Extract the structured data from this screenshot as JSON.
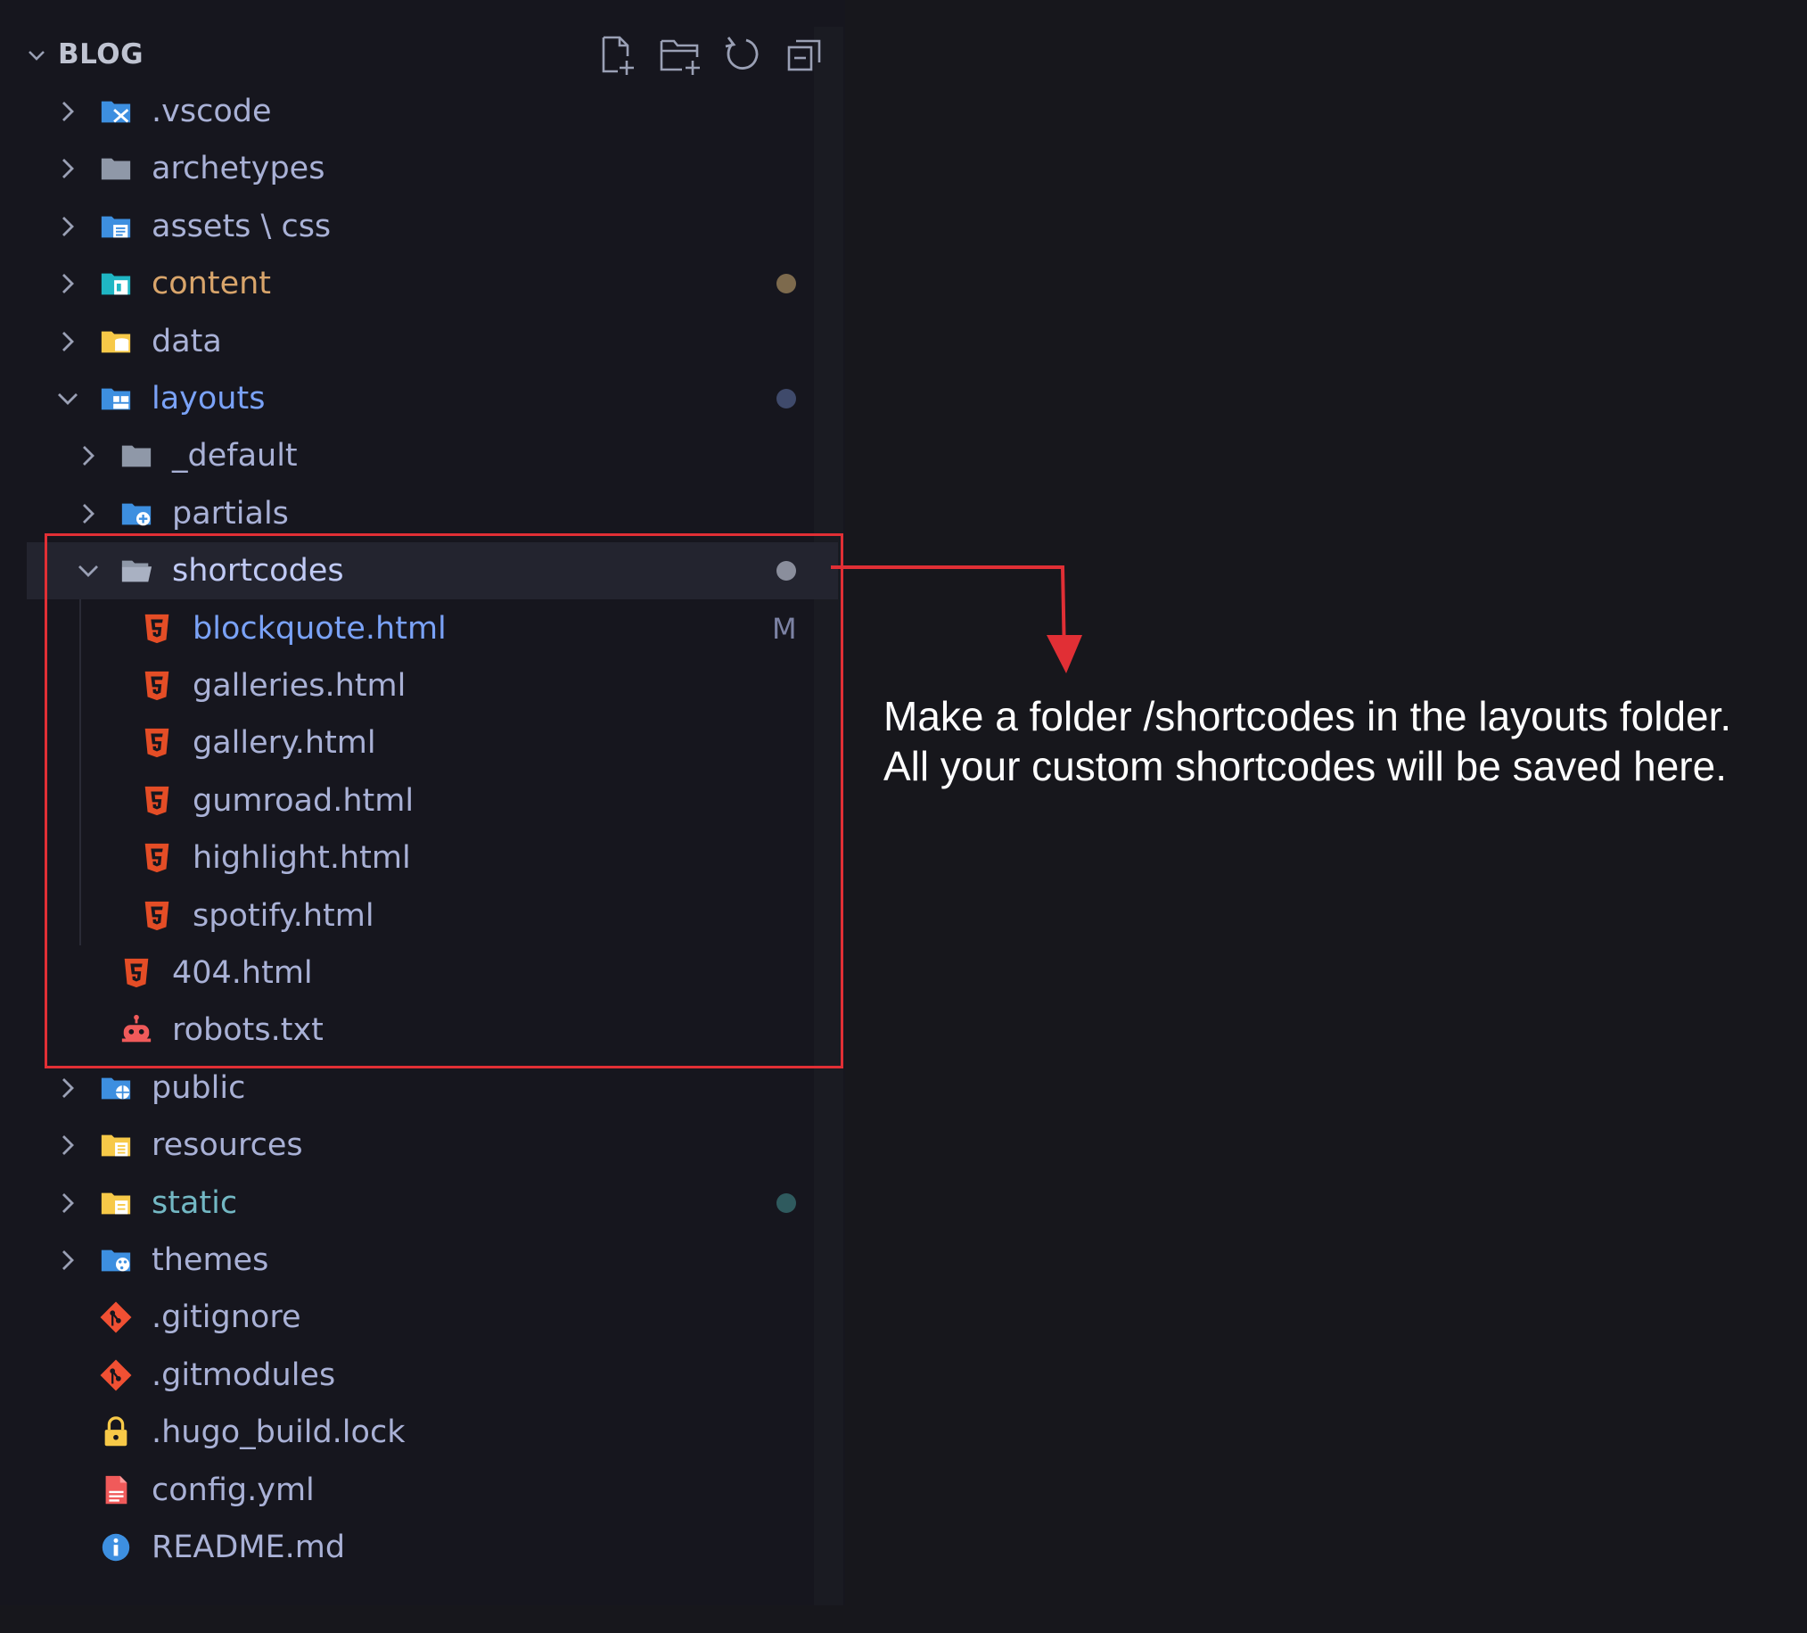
{
  "explorer": {
    "title": "BLOG",
    "header_actions": [
      {
        "name": "new-file-button",
        "icon": "new-file-icon"
      },
      {
        "name": "new-folder-button",
        "icon": "new-folder-icon"
      },
      {
        "name": "refresh-button",
        "icon": "refresh-icon"
      },
      {
        "name": "collapse-all-button",
        "icon": "collapse-all-icon"
      }
    ],
    "items": [
      {
        "label": ".vscode",
        "kind": "folder",
        "expanded": false,
        "depth": 0,
        "icon": "vscode-folder-icon",
        "color": "#a9b1d6"
      },
      {
        "label": "archetypes",
        "kind": "folder",
        "expanded": false,
        "depth": 0,
        "icon": "folder-icon",
        "color": "#a9b1d6"
      },
      {
        "label": "assets \\ css",
        "kind": "folder",
        "expanded": false,
        "depth": 0,
        "icon": "css-folder-icon",
        "color": "#a9b1d6"
      },
      {
        "label": "content",
        "kind": "folder",
        "expanded": false,
        "depth": 0,
        "icon": "content-folder-icon",
        "color": "#d9a56b",
        "dot_color": "#7d6a4d"
      },
      {
        "label": "data",
        "kind": "folder",
        "expanded": false,
        "depth": 0,
        "icon": "data-folder-icon",
        "color": "#a9b1d6"
      },
      {
        "label": "layouts",
        "kind": "folder",
        "expanded": true,
        "depth": 0,
        "icon": "layouts-folder-icon",
        "color": "#7aa2f7",
        "dot_color": "#3f4a6b"
      },
      {
        "label": "_default",
        "kind": "folder",
        "expanded": false,
        "depth": 1,
        "icon": "folder-icon",
        "color": "#a9b1d6"
      },
      {
        "label": "partials",
        "kind": "folder",
        "expanded": false,
        "depth": 1,
        "icon": "partials-folder-icon",
        "color": "#a9b1d6"
      },
      {
        "label": "shortcodes",
        "kind": "folder",
        "expanded": true,
        "depth": 1,
        "icon": "open-folder-icon",
        "color": "#c0caf5",
        "dot_color": "#8a8e9c",
        "selected": true
      },
      {
        "label": "blockquote.html",
        "kind": "file",
        "depth": 2,
        "icon": "html5-icon",
        "color": "#7aa2f7",
        "badge": "M"
      },
      {
        "label": "galleries.html",
        "kind": "file",
        "depth": 2,
        "icon": "html5-icon",
        "color": "#a9b1d6"
      },
      {
        "label": "gallery.html",
        "kind": "file",
        "depth": 2,
        "icon": "html5-icon",
        "color": "#a9b1d6"
      },
      {
        "label": "gumroad.html",
        "kind": "file",
        "depth": 2,
        "icon": "html5-icon",
        "color": "#a9b1d6"
      },
      {
        "label": "highlight.html",
        "kind": "file",
        "depth": 2,
        "icon": "html5-icon",
        "color": "#a9b1d6"
      },
      {
        "label": "spotify.html",
        "kind": "file",
        "depth": 2,
        "icon": "html5-icon",
        "color": "#a9b1d6"
      },
      {
        "label": "404.html",
        "kind": "file",
        "depth": 1,
        "icon": "html5-icon",
        "color": "#a9b1d6"
      },
      {
        "label": "robots.txt",
        "kind": "file",
        "depth": 1,
        "icon": "robot-icon",
        "color": "#a9b1d6"
      },
      {
        "label": "public",
        "kind": "folder",
        "expanded": false,
        "depth": 0,
        "icon": "public-folder-icon",
        "color": "#a9b1d6"
      },
      {
        "label": "resources",
        "kind": "folder",
        "expanded": false,
        "depth": 0,
        "icon": "resources-folder-icon",
        "color": "#a9b1d6"
      },
      {
        "label": "static",
        "kind": "folder",
        "expanded": false,
        "depth": 0,
        "icon": "static-folder-icon",
        "color": "#73b8c4",
        "dot_color": "#2f5a5e"
      },
      {
        "label": "themes",
        "kind": "folder",
        "expanded": false,
        "depth": 0,
        "icon": "themes-folder-icon",
        "color": "#a9b1d6"
      },
      {
        "label": ".gitignore",
        "kind": "file",
        "depth": 0,
        "icon": "git-icon",
        "color": "#a9b1d6"
      },
      {
        "label": ".gitmodules",
        "kind": "file",
        "depth": 0,
        "icon": "git-icon",
        "color": "#a9b1d6"
      },
      {
        "label": ".hugo_build.lock",
        "kind": "file",
        "depth": 0,
        "icon": "lock-icon",
        "color": "#a9b1d6"
      },
      {
        "label": "config.yml",
        "kind": "file",
        "depth": 0,
        "icon": "yaml-file-icon",
        "color": "#a9b1d6"
      },
      {
        "label": "README.md",
        "kind": "file",
        "depth": 0,
        "icon": "info-icon",
        "color": "#a9b1d6"
      }
    ]
  },
  "annotation": {
    "line1": "Make a folder /shortcodes in the layouts folder.",
    "line2": "All your custom shortcodes will be saved here."
  },
  "colors": {
    "highlight": "#e12f35",
    "html5": "#e44d26",
    "folder_blue": "#3d8fe0",
    "folder_yellow": "#f7c948"
  }
}
